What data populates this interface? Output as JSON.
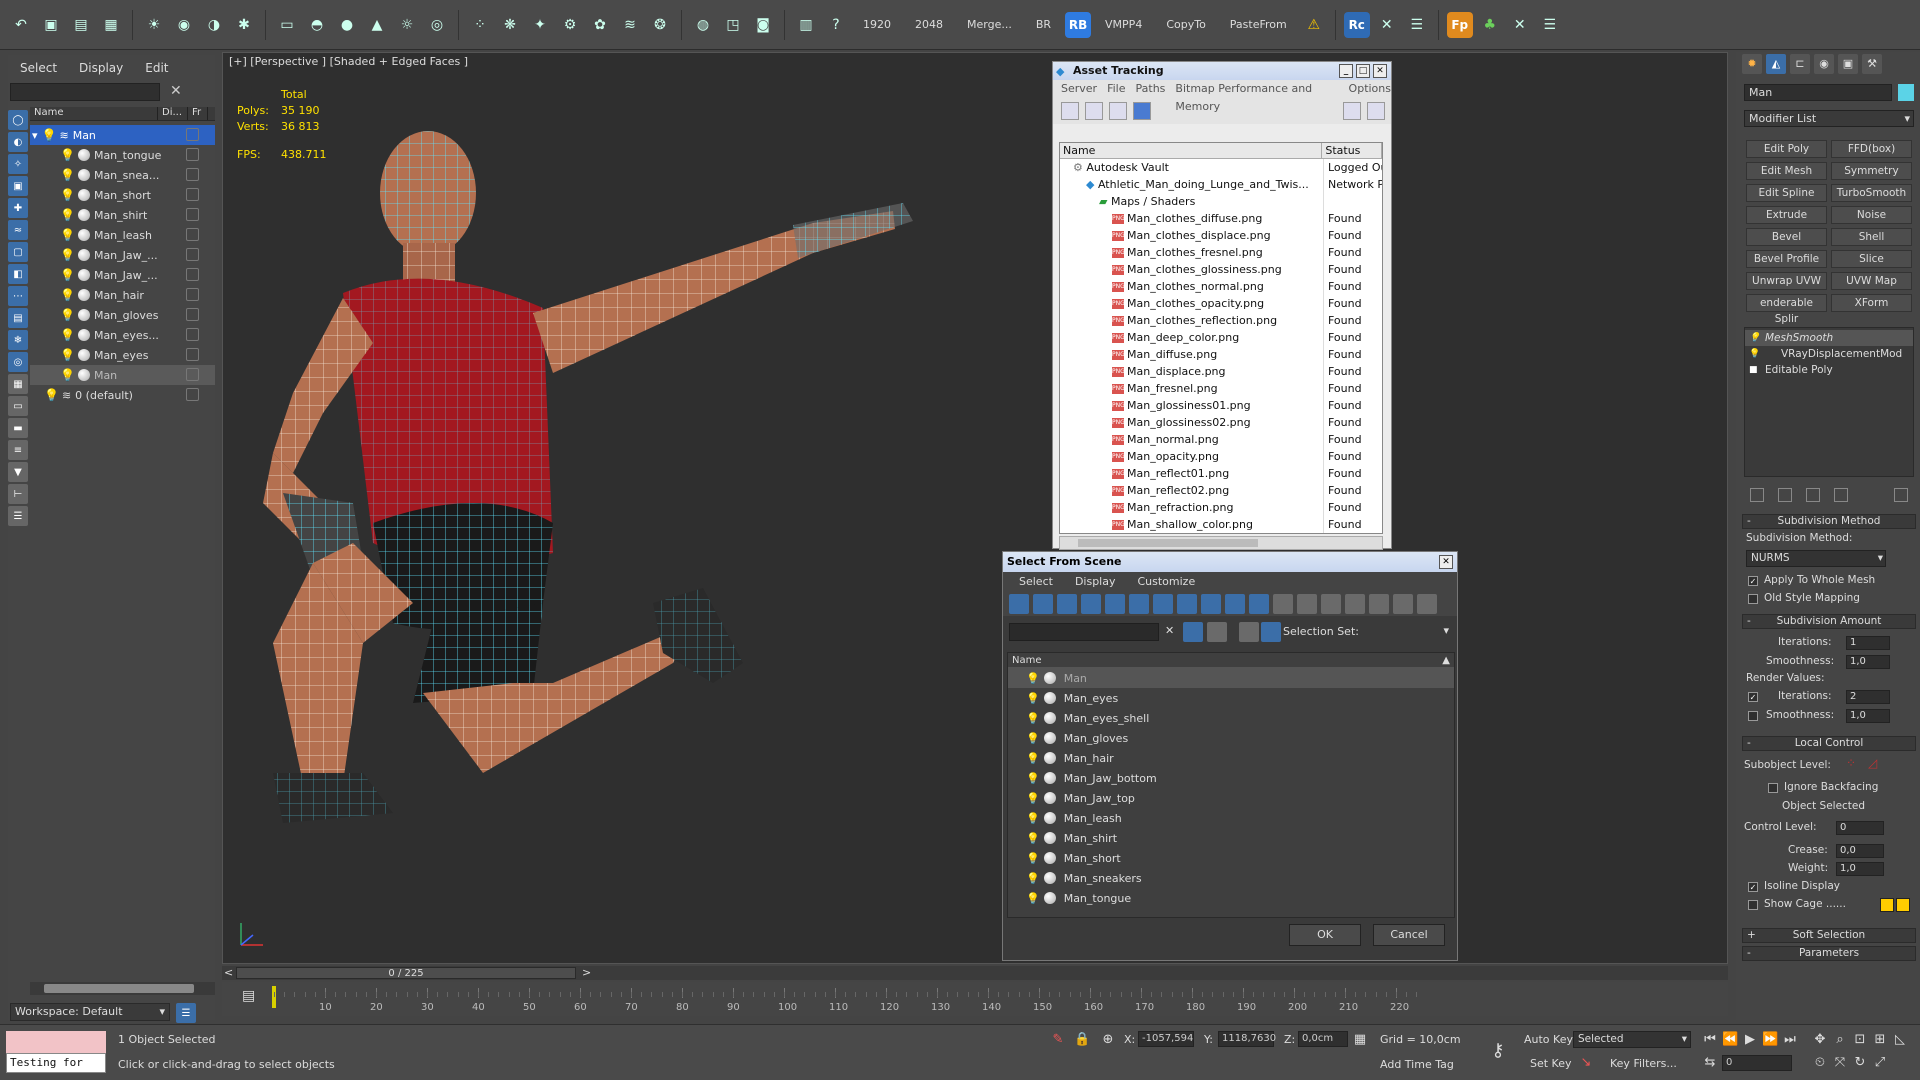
{
  "toolbar": {
    "texts": [
      "1920",
      "2048",
      "Merge...",
      "BR",
      "VMPP4",
      "CopyTo",
      "PasteFrom"
    ],
    "badges": [
      "RB",
      "Rc",
      "Fp"
    ]
  },
  "left_panel": {
    "tabs": [
      "Select",
      "Display",
      "Edit"
    ],
    "tree_headers": [
      "Name",
      "Di...",
      "Fr"
    ],
    "tree": [
      {
        "label": "Man",
        "level": 0
      },
      {
        "label": "Man_tongue",
        "level": 1
      },
      {
        "label": "Man_snea...",
        "level": 1
      },
      {
        "label": "Man_short",
        "level": 1
      },
      {
        "label": "Man_shirt",
        "level": 1
      },
      {
        "label": "Man_leash",
        "level": 1
      },
      {
        "label": "Man_Jaw_...",
        "level": 1
      },
      {
        "label": "Man_Jaw_...",
        "level": 1
      },
      {
        "label": "Man_hair",
        "level": 1
      },
      {
        "label": "Man_gloves",
        "level": 1
      },
      {
        "label": "Man_eyes...",
        "level": 1
      },
      {
        "label": "Man_eyes",
        "level": 1
      },
      {
        "label": "Man",
        "level": 1
      },
      {
        "label": "0 (default)",
        "level": 0
      }
    ],
    "workspace": "Workspace: Default"
  },
  "viewport": {
    "label": "[+] [Perspective ] [Shaded + Edged Faces ]",
    "stats": {
      "total": "Total",
      "polys_label": "Polys:",
      "polys": "35 190",
      "verts_label": "Verts:",
      "verts": "36 813",
      "fps_label": "FPS:",
      "fps": "438.711"
    }
  },
  "asset_tracking": {
    "title": "Asset Tracking",
    "menu": [
      "Server",
      "File",
      "Paths",
      "Bitmap Performance and Memory",
      "Options"
    ],
    "columns": [
      "Name",
      "Status"
    ],
    "rows": [
      {
        "name": "Autodesk Vault",
        "status": "Logged Out",
        "indent": 1
      },
      {
        "name": "Athletic_Man_doing_Lunge_and_Twis...",
        "status": "Network Pa",
        "indent": 2
      },
      {
        "name": "Maps / Shaders",
        "status": "",
        "indent": 3
      },
      {
        "name": "Man_clothes_diffuse.png",
        "status": "Found",
        "indent": 4
      },
      {
        "name": "Man_clothes_displace.png",
        "status": "Found",
        "indent": 4
      },
      {
        "name": "Man_clothes_fresnel.png",
        "status": "Found",
        "indent": 4
      },
      {
        "name": "Man_clothes_glossiness.png",
        "status": "Found",
        "indent": 4
      },
      {
        "name": "Man_clothes_normal.png",
        "status": "Found",
        "indent": 4
      },
      {
        "name": "Man_clothes_opacity.png",
        "status": "Found",
        "indent": 4
      },
      {
        "name": "Man_clothes_reflection.png",
        "status": "Found",
        "indent": 4
      },
      {
        "name": "Man_deep_color.png",
        "status": "Found",
        "indent": 4
      },
      {
        "name": "Man_diffuse.png",
        "status": "Found",
        "indent": 4
      },
      {
        "name": "Man_displace.png",
        "status": "Found",
        "indent": 4
      },
      {
        "name": "Man_fresnel.png",
        "status": "Found",
        "indent": 4
      },
      {
        "name": "Man_glossiness01.png",
        "status": "Found",
        "indent": 4
      },
      {
        "name": "Man_glossiness02.png",
        "status": "Found",
        "indent": 4
      },
      {
        "name": "Man_normal.png",
        "status": "Found",
        "indent": 4
      },
      {
        "name": "Man_opacity.png",
        "status": "Found",
        "indent": 4
      },
      {
        "name": "Man_reflect01.png",
        "status": "Found",
        "indent": 4
      },
      {
        "name": "Man_reflect02.png",
        "status": "Found",
        "indent": 4
      },
      {
        "name": "Man_refraction.png",
        "status": "Found",
        "indent": 4
      },
      {
        "name": "Man_shallow_color.png",
        "status": "Found",
        "indent": 4
      }
    ]
  },
  "select_from_scene": {
    "title": "Select From Scene",
    "menu": [
      "Select",
      "Display",
      "Customize"
    ],
    "selection_set": "Selection Set:",
    "column": "Name",
    "items": [
      "Man",
      "Man_eyes",
      "Man_eyes_shell",
      "Man_gloves",
      "Man_hair",
      "Man_Jaw_bottom",
      "Man_Jaw_top",
      "Man_leash",
      "Man_shirt",
      "Man_short",
      "Man_sneakers",
      "Man_tongue"
    ],
    "ok": "OK",
    "cancel": "Cancel"
  },
  "command_panel": {
    "object_name": "Man",
    "object_color": "#5bd3e7",
    "modifier_list": "Modifier List",
    "buttons": [
      "Edit Poly",
      "FFD(box)",
      "Edit Mesh",
      "Symmetry",
      "Edit Spline",
      "TurboSmooth",
      "Extrude",
      "Noise",
      "Bevel",
      "Shell",
      "Bevel Profile",
      "Slice",
      "Unwrap UVW",
      "UVW Map",
      "enderable Splir",
      "XForm"
    ],
    "stack": [
      "MeshSmooth",
      "VRayDisplacementMod",
      "Editable Poly"
    ],
    "subdivision_method_title": "Subdivision Method",
    "subdivision_method_label": "Subdivision Method:",
    "subdivision_method_value": "NURMS",
    "apply_whole_mesh": "Apply To Whole Mesh",
    "old_style_mapping": "Old Style Mapping",
    "subdivision_amount_title": "Subdivision Amount",
    "iterations_label": "Iterations:",
    "iterations": "1",
    "smoothness_label": "Smoothness:",
    "smoothness": "1,0",
    "render_values": "Render Values:",
    "render_iterations": "2",
    "render_smoothness": "1,0",
    "local_control_title": "Local Control",
    "subobject_level": "Subobject Level:",
    "ignore_backfacing": "Ignore Backfacing",
    "object_selected": "Object Selected",
    "control_level_label": "Control Level:",
    "control_level": "0",
    "crease_label": "Crease:",
    "crease": "0,0",
    "weight_label": "Weight:",
    "weight": "1,0",
    "isoline_display": "Isoline Display",
    "show_cage": "Show Cage ......",
    "soft_selection": "Soft Selection",
    "parameters": "Parameters"
  },
  "timeline": {
    "position": "0 / 225",
    "ticks": [
      "10",
      "20",
      "30",
      "40",
      "50",
      "60",
      "70",
      "80",
      "90",
      "100",
      "110",
      "120",
      "130",
      "140",
      "150",
      "160",
      "170",
      "180",
      "190",
      "200",
      "210",
      "220"
    ]
  },
  "status_bar": {
    "maxscript": "Testing for",
    "selected": "1 Object Selected",
    "prompt": "Click or click-and-drag to select objects",
    "x_label": "X:",
    "x": "-1057,594",
    "y_label": "Y:",
    "y": "1118,7630",
    "z_label": "Z:",
    "z": "0,0cm",
    "grid": "Grid = 10,0cm",
    "add_time_tag": "Add Time Tag",
    "auto_key": "Auto Key",
    "set_key": "Set Key",
    "selected_dropdown": "Selected",
    "key_filters": "Key Filters...",
    "frame": "0"
  }
}
